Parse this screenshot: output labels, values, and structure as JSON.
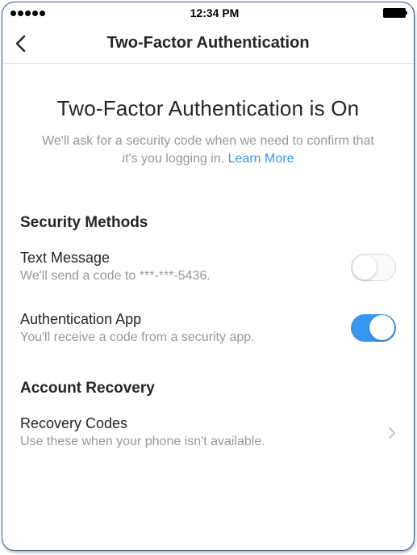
{
  "status_bar": {
    "time": "12:34 PM"
  },
  "nav": {
    "title": "Two-Factor Authentication"
  },
  "hero": {
    "title": "Two-Factor Authentication is On",
    "subtitle_prefix": "We'll ask for a security code when we need to confirm that it's you logging in. ",
    "learn_more": "Learn More"
  },
  "sections": {
    "security_methods": {
      "header": "Security Methods",
      "text_message": {
        "title": "Text Message",
        "subtitle": "We'll send a code to ***-***-5436.",
        "enabled": false
      },
      "auth_app": {
        "title": "Authentication App",
        "subtitle": "You'll receive a code from a security app.",
        "enabled": true
      }
    },
    "account_recovery": {
      "header": "Account Recovery",
      "recovery_codes": {
        "title": "Recovery Codes",
        "subtitle": "Use these when your phone isn't available."
      }
    }
  }
}
